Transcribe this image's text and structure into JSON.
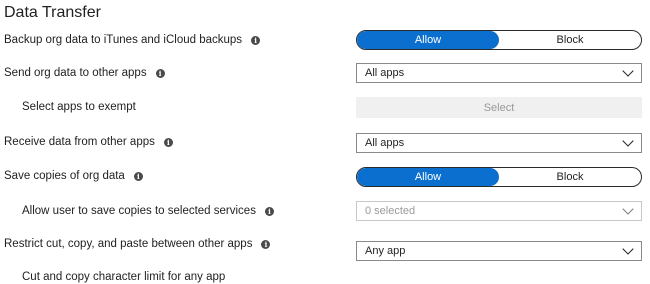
{
  "section": {
    "title": "Data Transfer"
  },
  "info_icon_glyph": "i",
  "rows": {
    "backup": {
      "label": "Backup org data to iTunes and iCloud backups",
      "options": [
        "Allow",
        "Block"
      ],
      "selected": "Allow"
    },
    "send": {
      "label": "Send org data to other apps",
      "value": "All apps"
    },
    "exempt": {
      "label": "Select apps to exempt",
      "button": "Select"
    },
    "receive": {
      "label": "Receive data from other apps",
      "value": "All apps"
    },
    "save_copies": {
      "label": "Save copies of org data",
      "options": [
        "Allow",
        "Block"
      ],
      "selected": "Allow"
    },
    "save_services": {
      "label": "Allow user to save copies to selected services",
      "value": "0 selected"
    },
    "restrict": {
      "label": "Restrict cut, copy, and paste between other apps",
      "value": "Any app"
    },
    "char_limit": {
      "label": "Cut and copy character limit for any app"
    }
  },
  "colors": {
    "accent": "#0a6fcf",
    "disabled_bg": "#f0f0f0",
    "disabled_text": "#9a9a9a"
  }
}
